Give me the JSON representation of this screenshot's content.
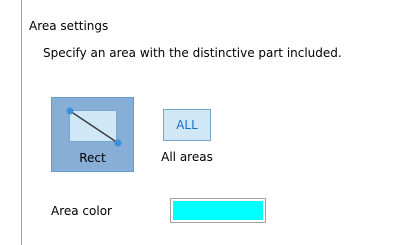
{
  "section": {
    "title": "Area settings",
    "description": "Specify an area with the distinctive part included."
  },
  "modes": {
    "rect": {
      "label": "Rect",
      "icon": "rect-select-icon",
      "selected": true
    },
    "all": {
      "label": "All areas",
      "icon_text": "ALL",
      "selected": false
    }
  },
  "area_color": {
    "label": "Area color",
    "value": "#00ffff"
  },
  "colors": {
    "selected_bg": "#87aed7",
    "icon_bg": "#cfe7f7",
    "accent": "#1b6fc0",
    "handle": "#3a8fd8"
  }
}
